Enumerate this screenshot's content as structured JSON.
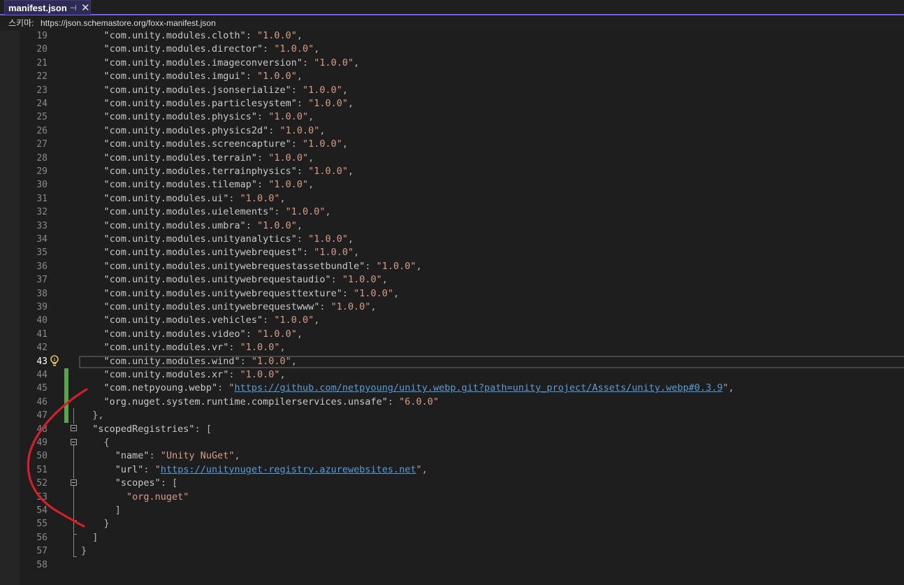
{
  "tab": {
    "title": "manifest.json",
    "pin_glyph": "⊣",
    "close_glyph": "✕"
  },
  "schema": {
    "label": "스키마:",
    "url": "https://json.schemastore.org/foxx-manifest.json"
  },
  "editor": {
    "current_line": "43",
    "colors": {
      "string": "#d69d85",
      "link": "#569cd6",
      "change_bar": "#57a64a",
      "annotation": "#d0202a"
    },
    "lines": [
      {
        "n": "19",
        "parts": [
          [
            "p",
            "    "
          ],
          [
            "k",
            "\"com.unity.modules.cloth\""
          ],
          [
            "p",
            ": "
          ],
          [
            "s",
            "\"1.0.0\""
          ],
          [
            "p",
            ","
          ]
        ]
      },
      {
        "n": "20",
        "parts": [
          [
            "p",
            "    "
          ],
          [
            "k",
            "\"com.unity.modules.director\""
          ],
          [
            "p",
            ": "
          ],
          [
            "s",
            "\"1.0.0\""
          ],
          [
            "p",
            ","
          ]
        ]
      },
      {
        "n": "21",
        "parts": [
          [
            "p",
            "    "
          ],
          [
            "k",
            "\"com.unity.modules.imageconversion\""
          ],
          [
            "p",
            ": "
          ],
          [
            "s",
            "\"1.0.0\""
          ],
          [
            "p",
            ","
          ]
        ]
      },
      {
        "n": "22",
        "parts": [
          [
            "p",
            "    "
          ],
          [
            "k",
            "\"com.unity.modules.imgui\""
          ],
          [
            "p",
            ": "
          ],
          [
            "s",
            "\"1.0.0\""
          ],
          [
            "p",
            ","
          ]
        ]
      },
      {
        "n": "23",
        "parts": [
          [
            "p",
            "    "
          ],
          [
            "k",
            "\"com.unity.modules.jsonserialize\""
          ],
          [
            "p",
            ": "
          ],
          [
            "s",
            "\"1.0.0\""
          ],
          [
            "p",
            ","
          ]
        ]
      },
      {
        "n": "24",
        "parts": [
          [
            "p",
            "    "
          ],
          [
            "k",
            "\"com.unity.modules.particlesystem\""
          ],
          [
            "p",
            ": "
          ],
          [
            "s",
            "\"1.0.0\""
          ],
          [
            "p",
            ","
          ]
        ]
      },
      {
        "n": "25",
        "parts": [
          [
            "p",
            "    "
          ],
          [
            "k",
            "\"com.unity.modules.physics\""
          ],
          [
            "p",
            ": "
          ],
          [
            "s",
            "\"1.0.0\""
          ],
          [
            "p",
            ","
          ]
        ]
      },
      {
        "n": "26",
        "parts": [
          [
            "p",
            "    "
          ],
          [
            "k",
            "\"com.unity.modules.physics2d\""
          ],
          [
            "p",
            ": "
          ],
          [
            "s",
            "\"1.0.0\""
          ],
          [
            "p",
            ","
          ]
        ]
      },
      {
        "n": "27",
        "parts": [
          [
            "p",
            "    "
          ],
          [
            "k",
            "\"com.unity.modules.screencapture\""
          ],
          [
            "p",
            ": "
          ],
          [
            "s",
            "\"1.0.0\""
          ],
          [
            "p",
            ","
          ]
        ]
      },
      {
        "n": "28",
        "parts": [
          [
            "p",
            "    "
          ],
          [
            "k",
            "\"com.unity.modules.terrain\""
          ],
          [
            "p",
            ": "
          ],
          [
            "s",
            "\"1.0.0\""
          ],
          [
            "p",
            ","
          ]
        ]
      },
      {
        "n": "29",
        "parts": [
          [
            "p",
            "    "
          ],
          [
            "k",
            "\"com.unity.modules.terrainphysics\""
          ],
          [
            "p",
            ": "
          ],
          [
            "s",
            "\"1.0.0\""
          ],
          [
            "p",
            ","
          ]
        ]
      },
      {
        "n": "30",
        "parts": [
          [
            "p",
            "    "
          ],
          [
            "k",
            "\"com.unity.modules.tilemap\""
          ],
          [
            "p",
            ": "
          ],
          [
            "s",
            "\"1.0.0\""
          ],
          [
            "p",
            ","
          ]
        ]
      },
      {
        "n": "31",
        "parts": [
          [
            "p",
            "    "
          ],
          [
            "k",
            "\"com.unity.modules.ui\""
          ],
          [
            "p",
            ": "
          ],
          [
            "s",
            "\"1.0.0\""
          ],
          [
            "p",
            ","
          ]
        ]
      },
      {
        "n": "32",
        "parts": [
          [
            "p",
            "    "
          ],
          [
            "k",
            "\"com.unity.modules.uielements\""
          ],
          [
            "p",
            ": "
          ],
          [
            "s",
            "\"1.0.0\""
          ],
          [
            "p",
            ","
          ]
        ]
      },
      {
        "n": "33",
        "parts": [
          [
            "p",
            "    "
          ],
          [
            "k",
            "\"com.unity.modules.umbra\""
          ],
          [
            "p",
            ": "
          ],
          [
            "s",
            "\"1.0.0\""
          ],
          [
            "p",
            ","
          ]
        ]
      },
      {
        "n": "34",
        "parts": [
          [
            "p",
            "    "
          ],
          [
            "k",
            "\"com.unity.modules.unityanalytics\""
          ],
          [
            "p",
            ": "
          ],
          [
            "s",
            "\"1.0.0\""
          ],
          [
            "p",
            ","
          ]
        ]
      },
      {
        "n": "35",
        "parts": [
          [
            "p",
            "    "
          ],
          [
            "k",
            "\"com.unity.modules.unitywebrequest\""
          ],
          [
            "p",
            ": "
          ],
          [
            "s",
            "\"1.0.0\""
          ],
          [
            "p",
            ","
          ]
        ]
      },
      {
        "n": "36",
        "parts": [
          [
            "p",
            "    "
          ],
          [
            "k",
            "\"com.unity.modules.unitywebrequestassetbundle\""
          ],
          [
            "p",
            ": "
          ],
          [
            "s",
            "\"1.0.0\""
          ],
          [
            "p",
            ","
          ]
        ]
      },
      {
        "n": "37",
        "parts": [
          [
            "p",
            "    "
          ],
          [
            "k",
            "\"com.unity.modules.unitywebrequestaudio\""
          ],
          [
            "p",
            ": "
          ],
          [
            "s",
            "\"1.0.0\""
          ],
          [
            "p",
            ","
          ]
        ]
      },
      {
        "n": "38",
        "parts": [
          [
            "p",
            "    "
          ],
          [
            "k",
            "\"com.unity.modules.unitywebrequesttexture\""
          ],
          [
            "p",
            ": "
          ],
          [
            "s",
            "\"1.0.0\""
          ],
          [
            "p",
            ","
          ]
        ]
      },
      {
        "n": "39",
        "parts": [
          [
            "p",
            "    "
          ],
          [
            "k",
            "\"com.unity.modules.unitywebrequestwww\""
          ],
          [
            "p",
            ": "
          ],
          [
            "s",
            "\"1.0.0\""
          ],
          [
            "p",
            ","
          ]
        ]
      },
      {
        "n": "40",
        "parts": [
          [
            "p",
            "    "
          ],
          [
            "k",
            "\"com.unity.modules.vehicles\""
          ],
          [
            "p",
            ": "
          ],
          [
            "s",
            "\"1.0.0\""
          ],
          [
            "p",
            ","
          ]
        ]
      },
      {
        "n": "41",
        "parts": [
          [
            "p",
            "    "
          ],
          [
            "k",
            "\"com.unity.modules.video\""
          ],
          [
            "p",
            ": "
          ],
          [
            "s",
            "\"1.0.0\""
          ],
          [
            "p",
            ","
          ]
        ]
      },
      {
        "n": "42",
        "parts": [
          [
            "p",
            "    "
          ],
          [
            "k",
            "\"com.unity.modules.vr\""
          ],
          [
            "p",
            ": "
          ],
          [
            "s",
            "\"1.0.0\""
          ],
          [
            "p",
            ","
          ]
        ]
      },
      {
        "n": "43",
        "parts": [
          [
            "p",
            "    "
          ],
          [
            "k",
            "\"com.unity.modules.wind\""
          ],
          [
            "p",
            ": "
          ],
          [
            "s",
            "\"1.0.0\""
          ],
          [
            "p",
            ","
          ]
        ]
      },
      {
        "n": "44",
        "parts": [
          [
            "p",
            "    "
          ],
          [
            "k",
            "\"com.unity.modules.xr\""
          ],
          [
            "p",
            ": "
          ],
          [
            "s",
            "\"1.0.0\""
          ],
          [
            "p",
            ","
          ]
        ]
      },
      {
        "n": "45",
        "parts": [
          [
            "p",
            "    "
          ],
          [
            "k",
            "\"com.netpyoung.webp\""
          ],
          [
            "p",
            ": "
          ],
          [
            "s",
            "\""
          ],
          [
            "u",
            "https://github.com/netpyoung/unity.webp.git?path=unity_project/Assets/unity.webp#0.3.9"
          ],
          [
            "s",
            "\""
          ],
          [
            "p",
            ","
          ]
        ]
      },
      {
        "n": "46",
        "parts": [
          [
            "p",
            "    "
          ],
          [
            "k",
            "\"org.nuget.system.runtime.compilerservices.unsafe\""
          ],
          [
            "p",
            ": "
          ],
          [
            "s",
            "\"6.0.0\""
          ]
        ]
      },
      {
        "n": "47",
        "parts": [
          [
            "p",
            "  },"
          ]
        ]
      },
      {
        "n": "48",
        "parts": [
          [
            "p",
            "  "
          ],
          [
            "k",
            "\"scopedRegistries\""
          ],
          [
            "p",
            ": ["
          ]
        ]
      },
      {
        "n": "49",
        "parts": [
          [
            "p",
            "    {"
          ]
        ]
      },
      {
        "n": "50",
        "parts": [
          [
            "p",
            "      "
          ],
          [
            "k",
            "\"name\""
          ],
          [
            "p",
            ": "
          ],
          [
            "s",
            "\"Unity NuGet\""
          ],
          [
            "p",
            ","
          ]
        ]
      },
      {
        "n": "51",
        "parts": [
          [
            "p",
            "      "
          ],
          [
            "k",
            "\"url\""
          ],
          [
            "p",
            ": "
          ],
          [
            "s",
            "\""
          ],
          [
            "u",
            "https://unitynuget-registry.azurewebsites.net"
          ],
          [
            "s",
            "\""
          ],
          [
            "p",
            ","
          ]
        ]
      },
      {
        "n": "52",
        "parts": [
          [
            "p",
            "      "
          ],
          [
            "k",
            "\"scopes\""
          ],
          [
            "p",
            ": ["
          ]
        ]
      },
      {
        "n": "53",
        "parts": [
          [
            "p",
            "        "
          ],
          [
            "s",
            "\"org.nuget\""
          ]
        ]
      },
      {
        "n": "54",
        "parts": [
          [
            "p",
            "      ]"
          ]
        ]
      },
      {
        "n": "55",
        "parts": [
          [
            "p",
            "    }"
          ]
        ]
      },
      {
        "n": "56",
        "parts": [
          [
            "p",
            "  ]"
          ]
        ]
      },
      {
        "n": "57",
        "parts": [
          [
            "p",
            "}"
          ]
        ]
      },
      {
        "n": "58",
        "parts": []
      }
    ]
  }
}
